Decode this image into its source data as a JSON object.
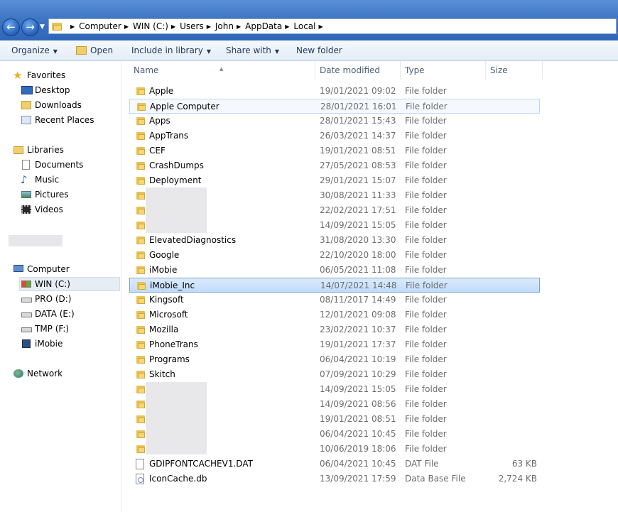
{
  "address": {
    "crumbs": [
      "Computer",
      "WIN (C:)",
      "Users",
      "John",
      "AppData",
      "Local"
    ]
  },
  "toolbar": {
    "organize": "Organize",
    "open": "Open",
    "include_in_library": "Include in library",
    "share_with": "Share with",
    "new_folder": "New folder"
  },
  "nav": {
    "favorites": "Favorites",
    "desktop": "Desktop",
    "downloads": "Downloads",
    "recent_places": "Recent Places",
    "libraries": "Libraries",
    "documents": "Documents",
    "music": "Music",
    "pictures": "Pictures",
    "videos": "Videos",
    "computer": "Computer",
    "win_c": "WIN (C:)",
    "pro_d": "PRO (D:)",
    "data_e": "DATA (E:)",
    "tmp_f": "TMP (F:)",
    "imobie": "iMobie",
    "network": "Network"
  },
  "columns": {
    "name": "Name",
    "date_modified": "Date modified",
    "type": "Type",
    "size": "Size"
  },
  "files": [
    {
      "name": "Apple",
      "date": "19/01/2021 09:02",
      "type": "File folder",
      "size": "",
      "icon": "folder-icon"
    },
    {
      "name": "Apple Computer",
      "date": "28/01/2021 16:01",
      "type": "File folder",
      "size": "",
      "icon": "folder-icon",
      "state": "hover"
    },
    {
      "name": "Apps",
      "date": "28/01/2021 15:43",
      "type": "File folder",
      "size": "",
      "icon": "folder-icon"
    },
    {
      "name": "AppTrans",
      "date": "26/03/2021 14:37",
      "type": "File folder",
      "size": "",
      "icon": "folder-icon"
    },
    {
      "name": "CEF",
      "date": "19/01/2021 08:51",
      "type": "File folder",
      "size": "",
      "icon": "folder-icon"
    },
    {
      "name": "CrashDumps",
      "date": "27/05/2021 08:53",
      "type": "File folder",
      "size": "",
      "icon": "folder-icon"
    },
    {
      "name": "Deployment",
      "date": "29/01/2021 15:07",
      "type": "File folder",
      "size": "",
      "icon": "folder-icon"
    },
    {
      "name": "",
      "date": "30/08/2021 11:33",
      "type": "File folder",
      "size": "",
      "icon": "folder-icon"
    },
    {
      "name": "",
      "date": "22/02/2021 17:51",
      "type": "File folder",
      "size": "",
      "icon": "folder-icon"
    },
    {
      "name": "",
      "date": "14/09/2021 15:05",
      "type": "File folder",
      "size": "",
      "icon": "folder-icon"
    },
    {
      "name": "ElevatedDiagnostics",
      "date": "31/08/2020 13:30",
      "type": "File folder",
      "size": "",
      "icon": "folder-icon"
    },
    {
      "name": "Google",
      "date": "22/10/2020 18:00",
      "type": "File folder",
      "size": "",
      "icon": "folder-icon"
    },
    {
      "name": "iMobie",
      "date": "06/05/2021 11:08",
      "type": "File folder",
      "size": "",
      "icon": "folder-icon"
    },
    {
      "name": "iMobie_Inc",
      "date": "14/07/2021 14:48",
      "type": "File folder",
      "size": "",
      "icon": "folder-icon",
      "state": "selected"
    },
    {
      "name": "Kingsoft",
      "date": "08/11/2017 14:49",
      "type": "File folder",
      "size": "",
      "icon": "folder-icon"
    },
    {
      "name": "Microsoft",
      "date": "12/01/2021 09:08",
      "type": "File folder",
      "size": "",
      "icon": "folder-icon"
    },
    {
      "name": "Mozilla",
      "date": "23/02/2021 10:37",
      "type": "File folder",
      "size": "",
      "icon": "folder-icon"
    },
    {
      "name": "PhoneTrans",
      "date": "19/01/2021 17:37",
      "type": "File folder",
      "size": "",
      "icon": "folder-icon"
    },
    {
      "name": "Programs",
      "date": "06/04/2021 10:19",
      "type": "File folder",
      "size": "",
      "icon": "folder-icon"
    },
    {
      "name": "Skitch",
      "date": "07/09/2021 10:29",
      "type": "File folder",
      "size": "",
      "icon": "folder-icon"
    },
    {
      "name": "",
      "date": "14/09/2021 15:05",
      "type": "File folder",
      "size": "",
      "icon": "folder-icon"
    },
    {
      "name": "",
      "date": "14/09/2021 08:56",
      "type": "File folder",
      "size": "",
      "icon": "folder-icon"
    },
    {
      "name": "",
      "date": "19/01/2021 08:51",
      "type": "File folder",
      "size": "",
      "icon": "folder-icon"
    },
    {
      "name": "",
      "date": "06/04/2021 10:45",
      "type": "File folder",
      "size": "",
      "icon": "folder-icon"
    },
    {
      "name": "",
      "date": "10/06/2019 18:06",
      "type": "File folder",
      "size": "",
      "icon": "folder-icon"
    },
    {
      "name": "GDIPFONTCACHEV1.DAT",
      "date": "06/04/2021 10:45",
      "type": "DAT File",
      "size": "63 KB",
      "icon": "file-icon"
    },
    {
      "name": "IconCache.db",
      "date": "13/09/2021 17:59",
      "type": "Data Base File",
      "size": "2,724 KB",
      "icon": "database-file-icon"
    }
  ]
}
